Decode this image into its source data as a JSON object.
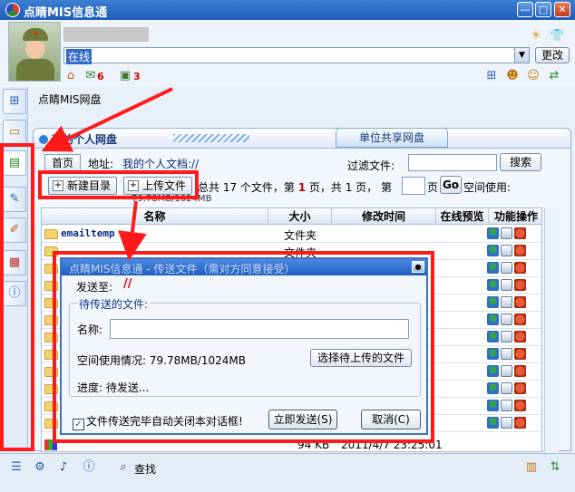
{
  "window": {
    "title": "点睛MIS信息通",
    "min_glyph": "—",
    "max_glyph": "□",
    "close_glyph": "✕"
  },
  "profile": {
    "status_text": "在线",
    "change_label": "更改",
    "count_a": "6",
    "count_b": "3"
  },
  "breadcrumb": "点睛MIS网盘",
  "panel": {
    "title": "我的个人网盘",
    "share_tab": "单位共享网盘"
  },
  "address": {
    "home_label": "首页",
    "addr_label": "地址:",
    "addr_value": "我的个人文档://",
    "filter_label": "过滤文件:",
    "search_label": "搜索"
  },
  "toolbar": {
    "new_dir_label": "新建目录",
    "upload_label": "上传文件",
    "page_prefix": "总共 17 个文件，第 ",
    "page_current": "1",
    "page_mid": " 页，共 1 页，  第",
    "page_suffix": "页",
    "go_label": "Go",
    "space_label": "空间使用:",
    "space_sub": "79.78MB/1024MB"
  },
  "table": {
    "headers": [
      "名称",
      "大小",
      "修改时间",
      "在线预览",
      "功能操作"
    ],
    "rows": [
      {
        "name": "emailtemp",
        "type": "文件夹"
      },
      {
        "name": "",
        "type": "文件夹"
      },
      {
        "name": "",
        "type": ""
      },
      {
        "name": "",
        "type": ""
      },
      {
        "name": "",
        "type": ""
      },
      {
        "name": "",
        "type": ""
      },
      {
        "name": "",
        "type": ""
      },
      {
        "name": "",
        "type": ""
      },
      {
        "name": "",
        "type": ""
      },
      {
        "name": "",
        "type": ""
      },
      {
        "name": "",
        "type": ""
      },
      {
        "name": "",
        "type": ""
      }
    ],
    "last_row": {
      "size": "94 KB",
      "time": "2011/4/7 23:25:01"
    }
  },
  "dialog": {
    "title": "点睛MIS信息通 - 传送文件（需对方同意接受）",
    "sendto_label": "发送至:",
    "sendto_value": "//",
    "legend": "待传送的文件:",
    "name_label": "名称:",
    "space_info": "空间使用情况: 79.78MB/1024MB",
    "pick_label": "选择待上传的文件",
    "progress": "进度: 待发送...",
    "autoclose_label": "文件传送完毕自动关闭本对话框!",
    "send_label": "立即发送(S)",
    "cancel_label": "取消(C)"
  },
  "bottom": {
    "find_label": "查找"
  },
  "colors": {
    "highlight": "#ff1a1a",
    "title_blue": "#1f5dc0",
    "accent_red": "#d00000"
  }
}
